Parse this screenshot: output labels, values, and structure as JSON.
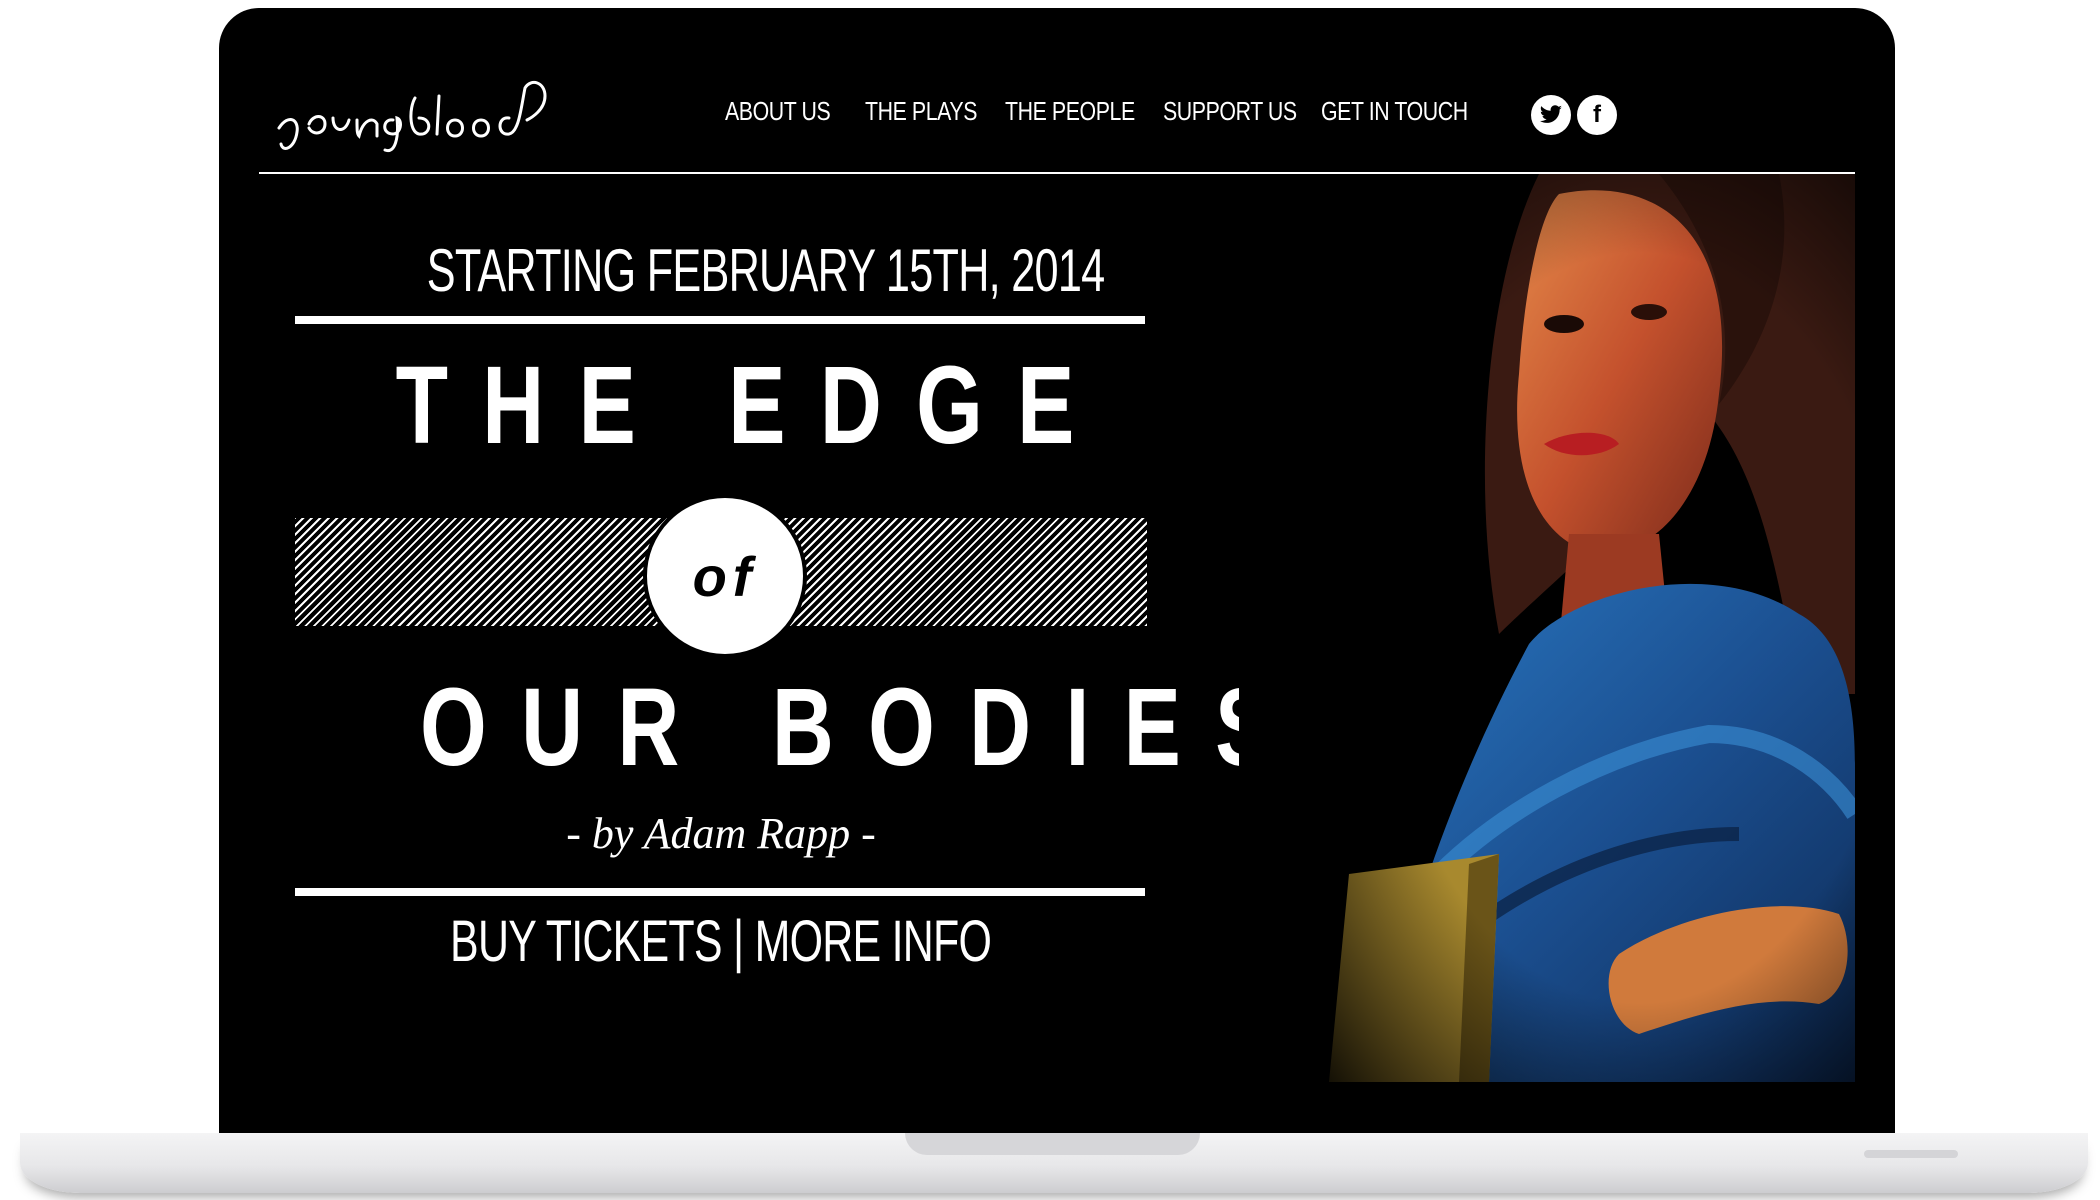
{
  "site": {
    "logo_text": "youngblood"
  },
  "nav": {
    "items": [
      {
        "label": "ABOUT US"
      },
      {
        "label": "THE PLAYS"
      },
      {
        "label": "THE PEOPLE"
      },
      {
        "label": "SUPPORT US"
      },
      {
        "label": "GET IN TOUCH"
      }
    ]
  },
  "social": {
    "twitter_icon": "twitter-icon",
    "facebook_icon": "facebook-icon",
    "facebook_glyph": "f"
  },
  "hero": {
    "date": "STARTING FEBRUARY 15TH, 2014",
    "title_line1": "THE EDGE",
    "title_of": "of",
    "title_line2": "OUR BODIES",
    "byline": "- by Adam Rapp -",
    "buy_tickets": "BUY TICKETS",
    "separator": "|",
    "more_info": "MORE INFO"
  },
  "colors": {
    "background": "#000000",
    "text": "#ffffff",
    "scarf_blue": "#1f5fa8"
  }
}
